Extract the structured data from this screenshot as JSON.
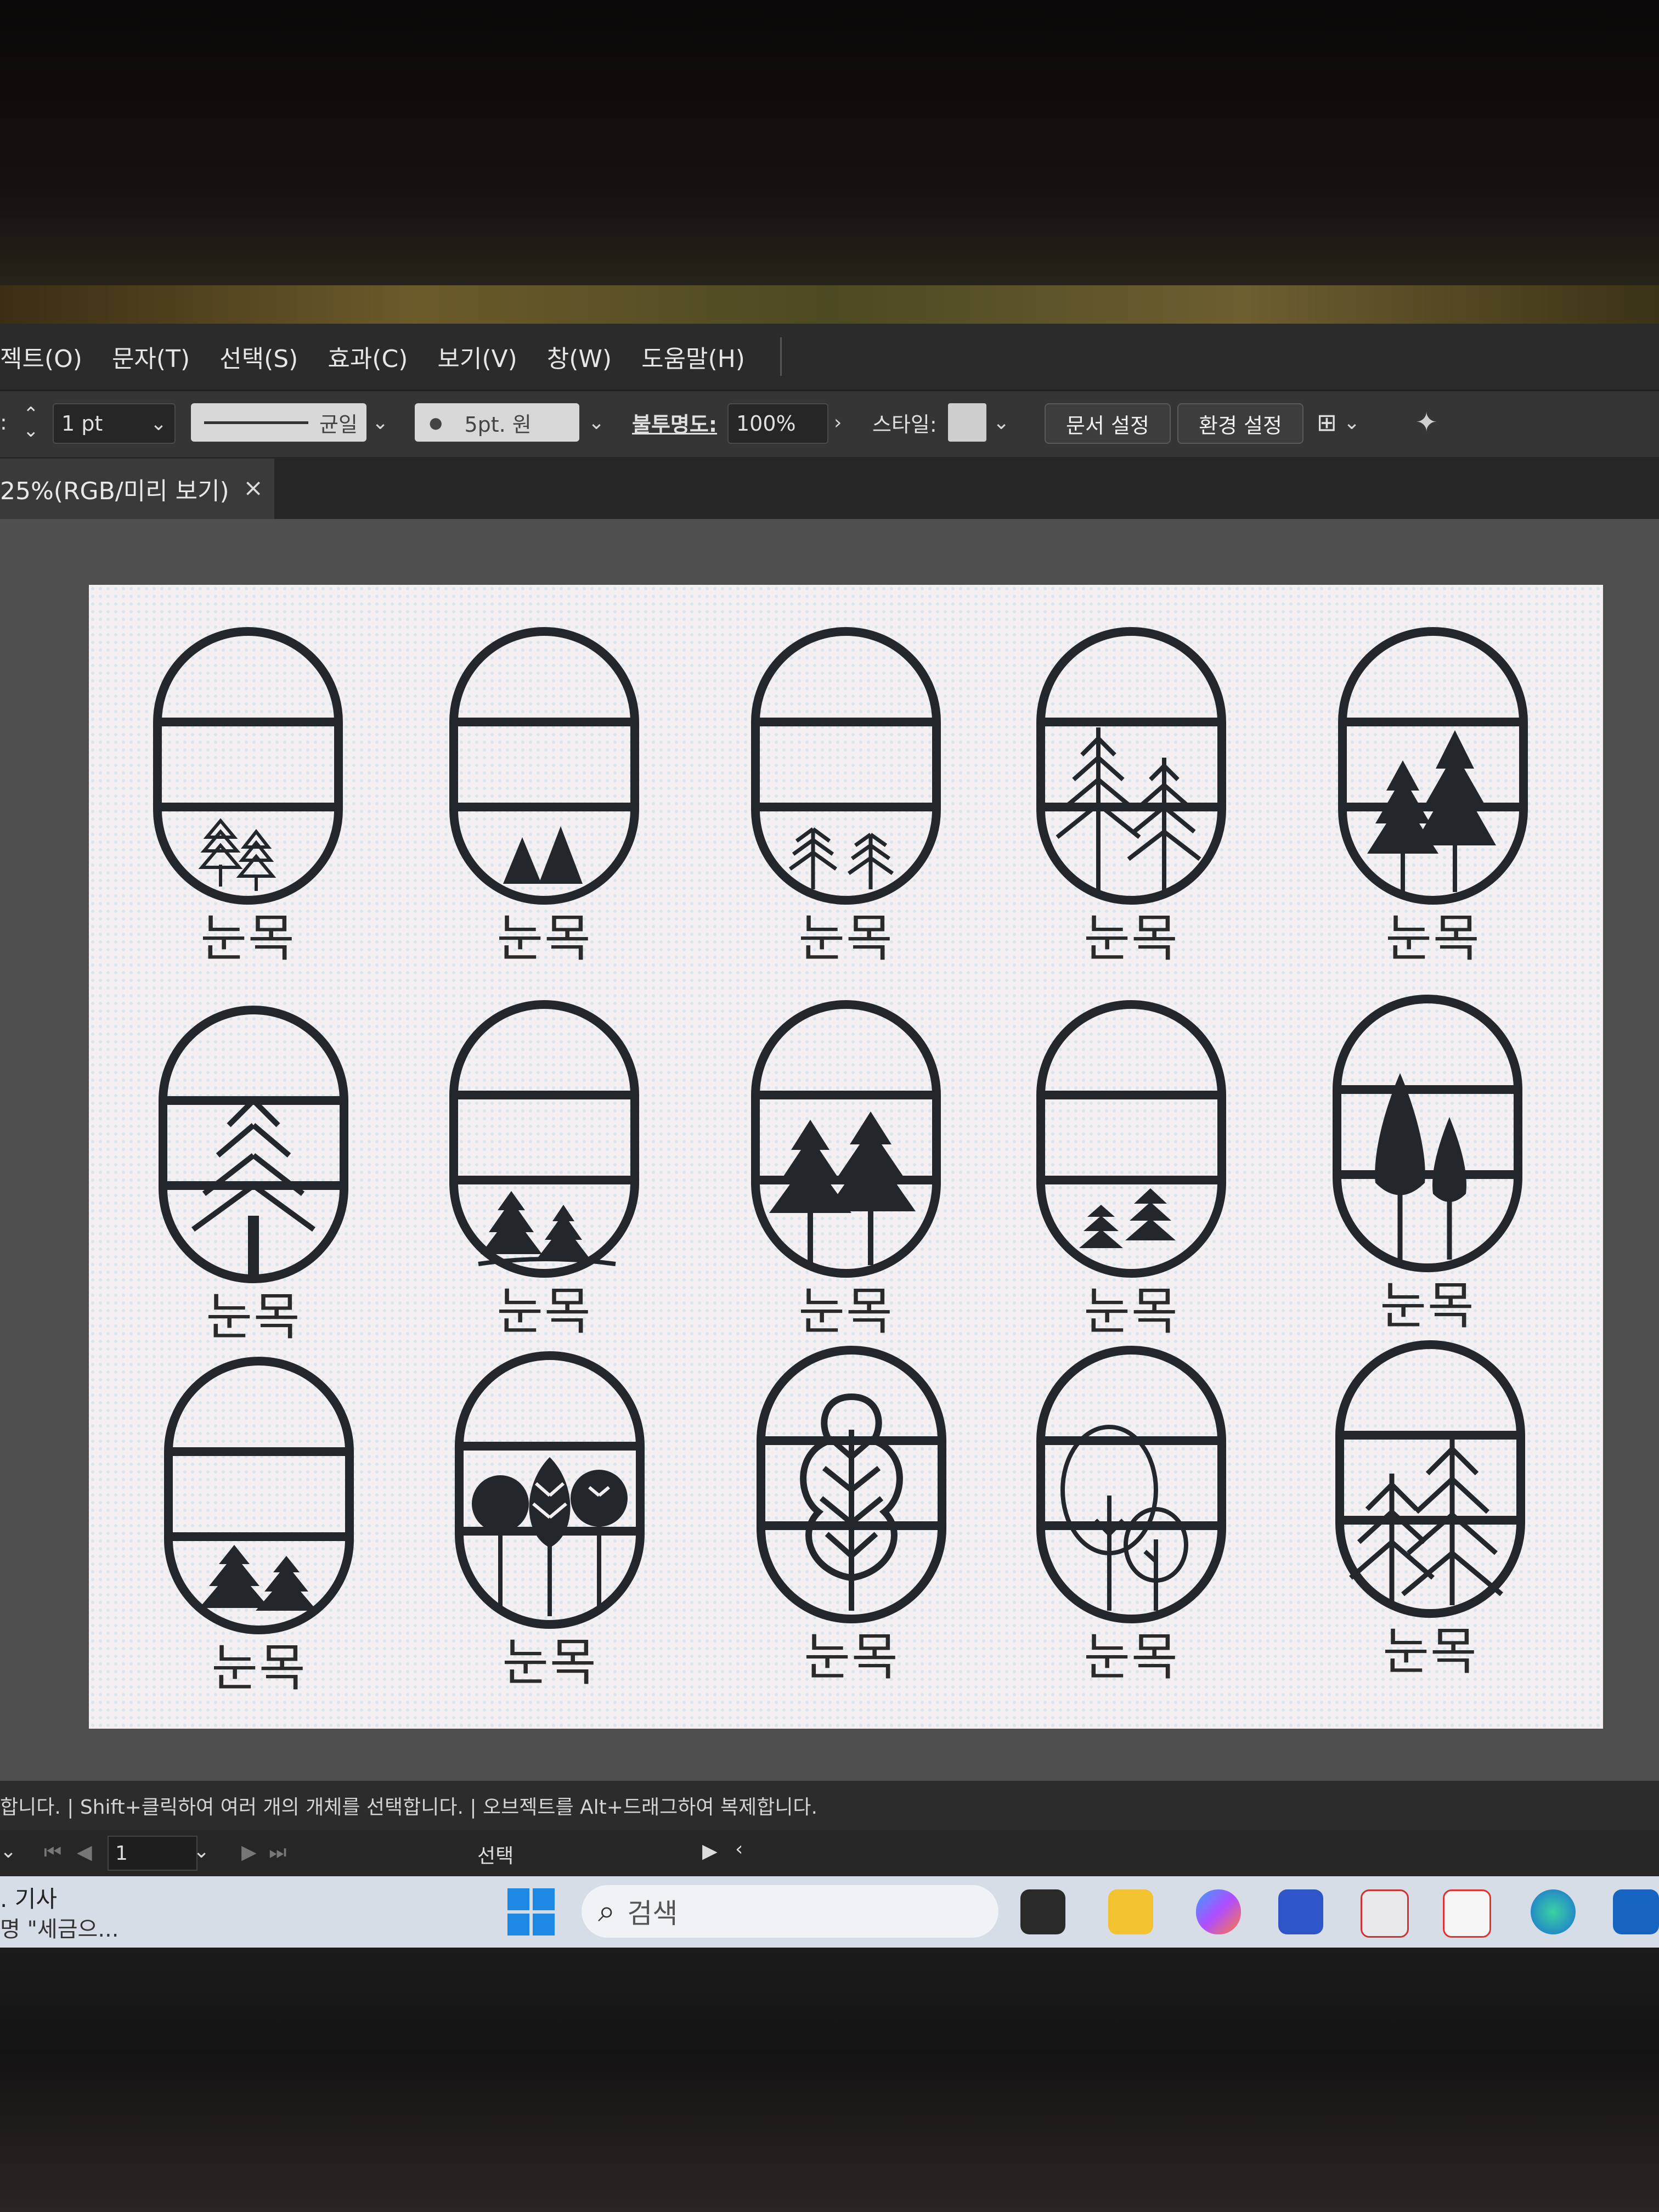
{
  "menubar": {
    "items": [
      "젝트(O)",
      "문자(T)",
      "선택(S)",
      "효과(C)",
      "보기(V)",
      "창(W)",
      "도움말(H)"
    ]
  },
  "control_bar": {
    "stroke_weight": "1 pt",
    "stroke_profile": "균일",
    "brush": "5pt. 원",
    "opacity_label": "불투명도:",
    "opacity_value": "100%",
    "style_label": "스타일:",
    "doc_setup_button": "문서 설정",
    "preferences_button": "환경 설정"
  },
  "document_tab": {
    "title": "25%(RGB/미리 보기)",
    "close": "×"
  },
  "artboard": {
    "icon_label": "눈목",
    "rows": [
      [
        "small-sketch-pines",
        "two-solid-pines",
        "layered-pines",
        "tall-line-pines",
        "solid-fir-pair"
      ],
      [
        "chevron-pine",
        "pines-on-hill",
        "two-solid-firs",
        "stacked-pines",
        "two-cypress"
      ],
      [
        "two-solid-pines-bottom",
        "round-trees",
        "leaf-tree",
        "outline-round-trees",
        "line-fir-pair"
      ]
    ]
  },
  "statusbar": {
    "text": "합니다.  |  Shift+클릭하여 여러 개의 개체를 선택합니다.  |  오브젝트를 Alt+드래그하여 복제합니다."
  },
  "pagebar": {
    "page": "1",
    "tool": "선택"
  },
  "taskbar": {
    "news_title": ". 기사",
    "news_sub": "명 \"세금으...",
    "search_label": "검색"
  },
  "colors": {
    "icon_stroke": "#23272c",
    "ui_dark": "#2b2b2b",
    "artboard_bg": "#f4f0f2",
    "start_blue": "#1e88e5"
  }
}
